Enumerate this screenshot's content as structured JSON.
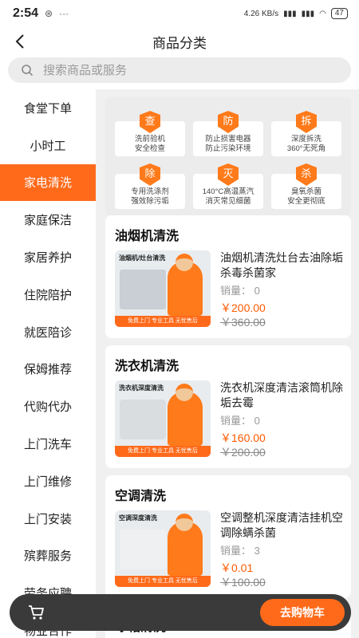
{
  "statusbar": {
    "time": "2:54",
    "network": "4.26 KB/s",
    "signal1": "HD",
    "signal2": "HD",
    "battery": "47"
  },
  "navbar": {
    "title": "商品分类"
  },
  "search": {
    "placeholder": "搜索商品或服务"
  },
  "sidebar": {
    "items": [
      {
        "label": "食堂下单"
      },
      {
        "label": "小时工"
      },
      {
        "label": "家电清洗"
      },
      {
        "label": "家庭保洁"
      },
      {
        "label": "家居养护"
      },
      {
        "label": "住院陪护"
      },
      {
        "label": "就医陪诊"
      },
      {
        "label": "保姆推荐"
      },
      {
        "label": "代购代办"
      },
      {
        "label": "上门洗车"
      },
      {
        "label": "上门维修"
      },
      {
        "label": "上门安装"
      },
      {
        "label": "殡葬服务"
      },
      {
        "label": "劳务应聘"
      },
      {
        "label": "物业合作"
      }
    ],
    "active_index": 2
  },
  "features": [
    {
      "badge": "查",
      "line1": "洗前验机",
      "line2": "安全检查"
    },
    {
      "badge": "防",
      "line1": "防止损害电器",
      "line2": "防止污染环境"
    },
    {
      "badge": "拆",
      "line1": "深度拆洗",
      "line2": "360°无死角"
    },
    {
      "badge": "除",
      "line1": "专用洗涤剂",
      "line2": "强效除污垢"
    },
    {
      "badge": "灭",
      "line1": "140°C高温蒸汽",
      "line2": "消灭常见细菌"
    },
    {
      "badge": "杀",
      "line1": "臭氧杀菌",
      "line2": "安全更彻底"
    }
  ],
  "sections": [
    {
      "title": "油烟机清洗",
      "thumb_label": "油烟机/灶台清洗",
      "thumb_banner": "免费上门 专业工具 无忧售后",
      "name": "油烟机清洗灶台去油除垢杀毒杀菌家",
      "sales": "销量： 0",
      "price": "￥200.00",
      "old_price": "￥360.00"
    },
    {
      "title": "洗衣机清洗",
      "thumb_label": "洗衣机深度清洗",
      "thumb_banner": "免费上门 专业工具 无忧售后",
      "name": "洗衣机深度清洁滚筒机除垢去霉",
      "sales": "销量： 0",
      "price": "￥160.00",
      "old_price": "￥200.00"
    },
    {
      "title": "空调清洗",
      "thumb_label": "空调深度清洗",
      "thumb_banner": "免费上门 专业工具 无忧售后",
      "name": "空调整机深度清洁挂机空调除螨杀菌",
      "sales": "销量： 3",
      "price": "￥0.01",
      "old_price": "￥100.00"
    },
    {
      "title": "冰箱清洗"
    }
  ],
  "cart": {
    "button_label": "去购物车"
  }
}
